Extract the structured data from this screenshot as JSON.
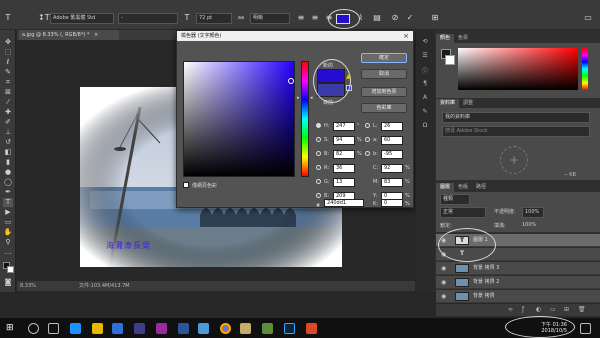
{
  "options_bar": {
    "font_family": "Adobe 繁黑體 Std",
    "font_style": "-",
    "font_size": "72 pt",
    "antialias_icon": "aa",
    "antialias": "明晰"
  },
  "document_tab": {
    "title": "a.jpg @ 8.33% (, RGB/8*) *",
    "close": "×"
  },
  "status_bar": {
    "zoom": "8.33%",
    "doc_info": "文件:103.4M/413.7M",
    "arrow": "›"
  },
  "photo": {
    "caption": "海灘漁長榮"
  },
  "color_picker": {
    "title": "檢色器 (文字顏色)",
    "close": "×",
    "new_label": "新的",
    "current_label": "目前",
    "buttons": {
      "ok": "確定",
      "cancel": "取消",
      "add_swatch": "增加到色票",
      "libraries": "色彩庫"
    },
    "only_web_colors": "僅網頁色彩",
    "fields": {
      "H": {
        "label": "H:",
        "value": "247",
        "unit": "°"
      },
      "S": {
        "label": "S:",
        "value": "94",
        "unit": "%"
      },
      "B": {
        "label": "B:",
        "value": "82",
        "unit": "%"
      },
      "R": {
        "label": "R:",
        "value": "36",
        "unit": ""
      },
      "G": {
        "label": "G:",
        "value": "13",
        "unit": ""
      },
      "Bl": {
        "label": "B:",
        "value": "209",
        "unit": ""
      },
      "L": {
        "label": "L:",
        "value": "26",
        "unit": ""
      },
      "a": {
        "label": "a:",
        "value": "60",
        "unit": ""
      },
      "b": {
        "label": "b:",
        "value": "-95",
        "unit": ""
      },
      "C": {
        "label": "C:",
        "value": "92",
        "unit": "%"
      },
      "M": {
        "label": "M:",
        "value": "83",
        "unit": "%"
      },
      "Y": {
        "label": "Y:",
        "value": "0",
        "unit": "%"
      },
      "K": {
        "label": "K:",
        "value": "0",
        "unit": "%"
      }
    },
    "hex_label": "#",
    "hex": "240dd1"
  },
  "right_panels": {
    "color_tabs": [
      "顏色",
      "色票"
    ],
    "library_tabs": [
      "資料庫",
      "調整"
    ],
    "library_select": "我的資料庫",
    "library_search": "搜尋 Adobe Stock",
    "library_size": "-- KB",
    "layers_tabs": [
      "圖層",
      "色版",
      "路徑"
    ],
    "kind_label": "種類",
    "blend_mode": "正常",
    "opacity_label": "不透明度:",
    "opacity": "100%",
    "lock_label": "鎖定:",
    "fill_label": "填滿:",
    "fill": "100%",
    "layers": [
      {
        "name": "圖層 1",
        "thumb": "T"
      },
      {
        "name": "",
        "thumb": "T"
      },
      {
        "name": "背景 拷貝 3",
        "thumb": ""
      },
      {
        "name": "背景 拷貝 2",
        "thumb": ""
      },
      {
        "name": "背景 拷貝",
        "thumb": ""
      }
    ]
  },
  "taskbar": {
    "time": "下午 01:36",
    "date": "2018/10/5"
  },
  "colors": {
    "selected_color": "#240dd1",
    "current_color": "#3a3aa8",
    "accent_hue": "#2400ff"
  }
}
